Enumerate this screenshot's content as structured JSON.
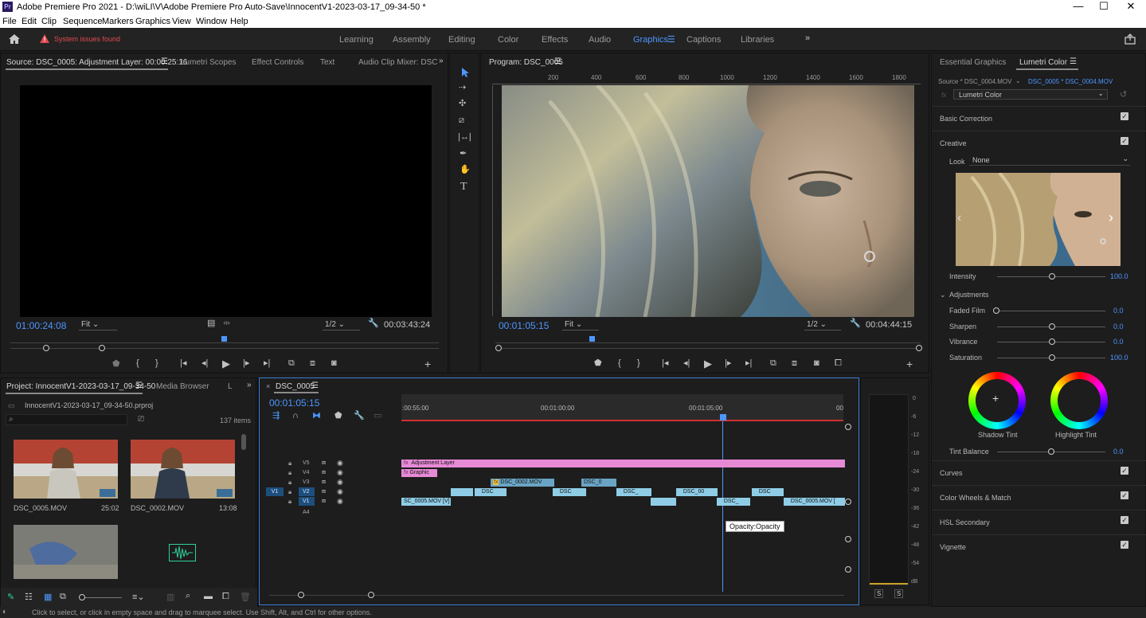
{
  "window": {
    "title": "Adobe Premiere Pro 2021 - D:\\wiLI\\V\\Adobe Premiere Pro Auto-Save\\InnocentV1-2023-03-17_09-34-50 *",
    "app_icon": "Pr"
  },
  "menu": [
    "File",
    "Edit",
    "Clip",
    "Sequence",
    "Markers",
    "Graphics",
    "View",
    "Window",
    "Help"
  ],
  "workspace": {
    "alert": "System issues found",
    "tabs": [
      "Learning",
      "Assembly",
      "Editing",
      "Color",
      "Effects",
      "Audio",
      "Graphics",
      "Captions",
      "Libraries"
    ],
    "active": "Graphics"
  },
  "source": {
    "tabs": [
      "Source: DSC_0005: Adjustment Layer: 00:00:25:16",
      "Lumetri Scopes",
      "Effect Controls",
      "Text",
      "Audio Clip Mixer: DSC"
    ],
    "timecode": "01:00:24:08",
    "fit": "Fit",
    "resolution": "1/2",
    "duration": "00:03:43:24"
  },
  "program": {
    "title": "Program: DSC_0005",
    "ruler": [
      "200",
      "400",
      "600",
      "800",
      "1000",
      "1200",
      "1400",
      "1600",
      "1800"
    ],
    "timecode": "00:01:05:15",
    "fit": "Fit",
    "resolution": "1/2",
    "duration": "00:04:44:15"
  },
  "project": {
    "tabs": [
      "Project: InnocentV1-2023-03-17_09-34-50",
      "Media Browser",
      "L"
    ],
    "file": "InnocentV1-2023-03-17_09-34-50.prproj",
    "count": "137 items",
    "items": [
      {
        "name": "DSC_0005.MOV",
        "dur": "25:02"
      },
      {
        "name": "DSC_0002.MOV",
        "dur": "13:08"
      }
    ]
  },
  "timeline": {
    "tab": "DSC_0005",
    "timecode": "00:01:05:15",
    "ruler": [
      ":00:55:00",
      "00:01:00:00",
      "00:01:05:00",
      "00"
    ],
    "tracks": [
      "V5",
      "V4",
      "V3",
      "V2",
      "V1",
      "A4"
    ],
    "source_patch": "V1",
    "clips": {
      "adjustment": "Adjustment Layer",
      "graphic": "Graphic",
      "v3a": "DSC_0002.MOV",
      "v3b": "DSC_0",
      "v2a": "DSC",
      "v2b": "DSC",
      "v2c": "DSC_",
      "v2d": "DSC_00",
      "v2e": "DSC",
      "v1a": "SC_0005.MOV [V]",
      "v1b": "DSC_",
      "v1c": "DSC_0005.MOV [",
      "fx": "fx"
    },
    "tooltip": "Opacity:Opacity"
  },
  "meter": {
    "scale": [
      "0",
      "-6",
      "-12",
      "-18",
      "-24",
      "-30",
      "-36",
      "-42",
      "-48",
      "-54",
      "dB"
    ],
    "solo": [
      "S",
      "S"
    ]
  },
  "lumetri": {
    "tabs": [
      "Essential Graphics",
      "Lumetri Color"
    ],
    "source": "Source * DSC_0004.MOV",
    "target": "DSC_0005 * DSC_0004.MOV",
    "fx_label": "fx",
    "effect": "Lumetri Color",
    "sections": {
      "basic": "Basic Correction",
      "creative": "Creative",
      "curves": "Curves",
      "wheels": "Color Wheels & Match",
      "hsl": "HSL Secondary",
      "vignette": "Vignette"
    },
    "look_label": "Look",
    "look_value": "None",
    "intensity_label": "Intensity",
    "intensity": "100.0",
    "adjustments": "Adjustments",
    "sliders": [
      {
        "label": "Faded Film",
        "value": "0.0",
        "level": 0
      },
      {
        "label": "Sharpen",
        "value": "0.0",
        "level": 0.5
      },
      {
        "label": "Vibrance",
        "value": "0.0",
        "level": 0.5
      },
      {
        "label": "Saturation",
        "value": "100.0",
        "level": 0.5
      }
    ],
    "shadow_tint": "Shadow Tint",
    "highlight_tint": "Highlight Tint",
    "tint_balance_label": "Tint Balance",
    "tint_balance": "0.0"
  },
  "status": "Click to select, or click in empty space and drag to marquee select. Use Shift, Alt, and Ctrl for other options."
}
